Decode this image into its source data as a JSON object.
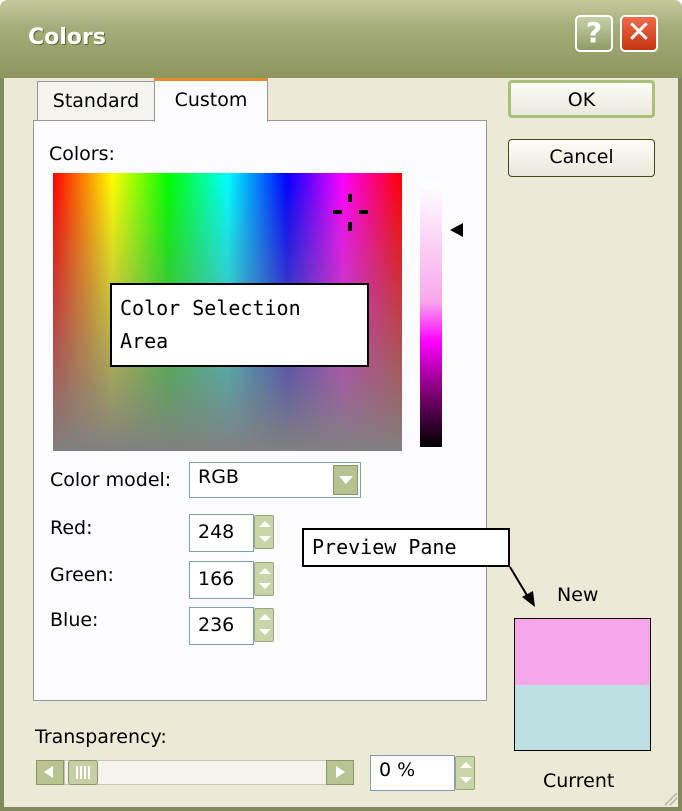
{
  "window": {
    "title": "Colors"
  },
  "titlebar": {
    "help_glyph": "?",
    "close_glyph": "✕"
  },
  "tabs": [
    {
      "label": "Standard",
      "selected": false
    },
    {
      "label": "Custom",
      "selected": true
    }
  ],
  "custom": {
    "colors_label": "Colors:",
    "color_model": {
      "label": "Color model:",
      "value": "RGB"
    },
    "red": {
      "label": "Red:",
      "value": "248"
    },
    "green": {
      "label": "Green:",
      "value": "166"
    },
    "blue": {
      "label": "Blue:",
      "value": "236"
    }
  },
  "callouts": {
    "color_selection": [
      "Color Selection",
      "Area"
    ],
    "preview": "Preview Pane"
  },
  "buttons": {
    "ok": "OK",
    "cancel": "Cancel"
  },
  "preview": {
    "new_label": "New",
    "current_label": "Current",
    "new_color": "#f7a6ea",
    "current_color": "#bde0e2"
  },
  "transparency": {
    "label": "Transparency:",
    "value": "0 %",
    "slider_percent": 0
  }
}
